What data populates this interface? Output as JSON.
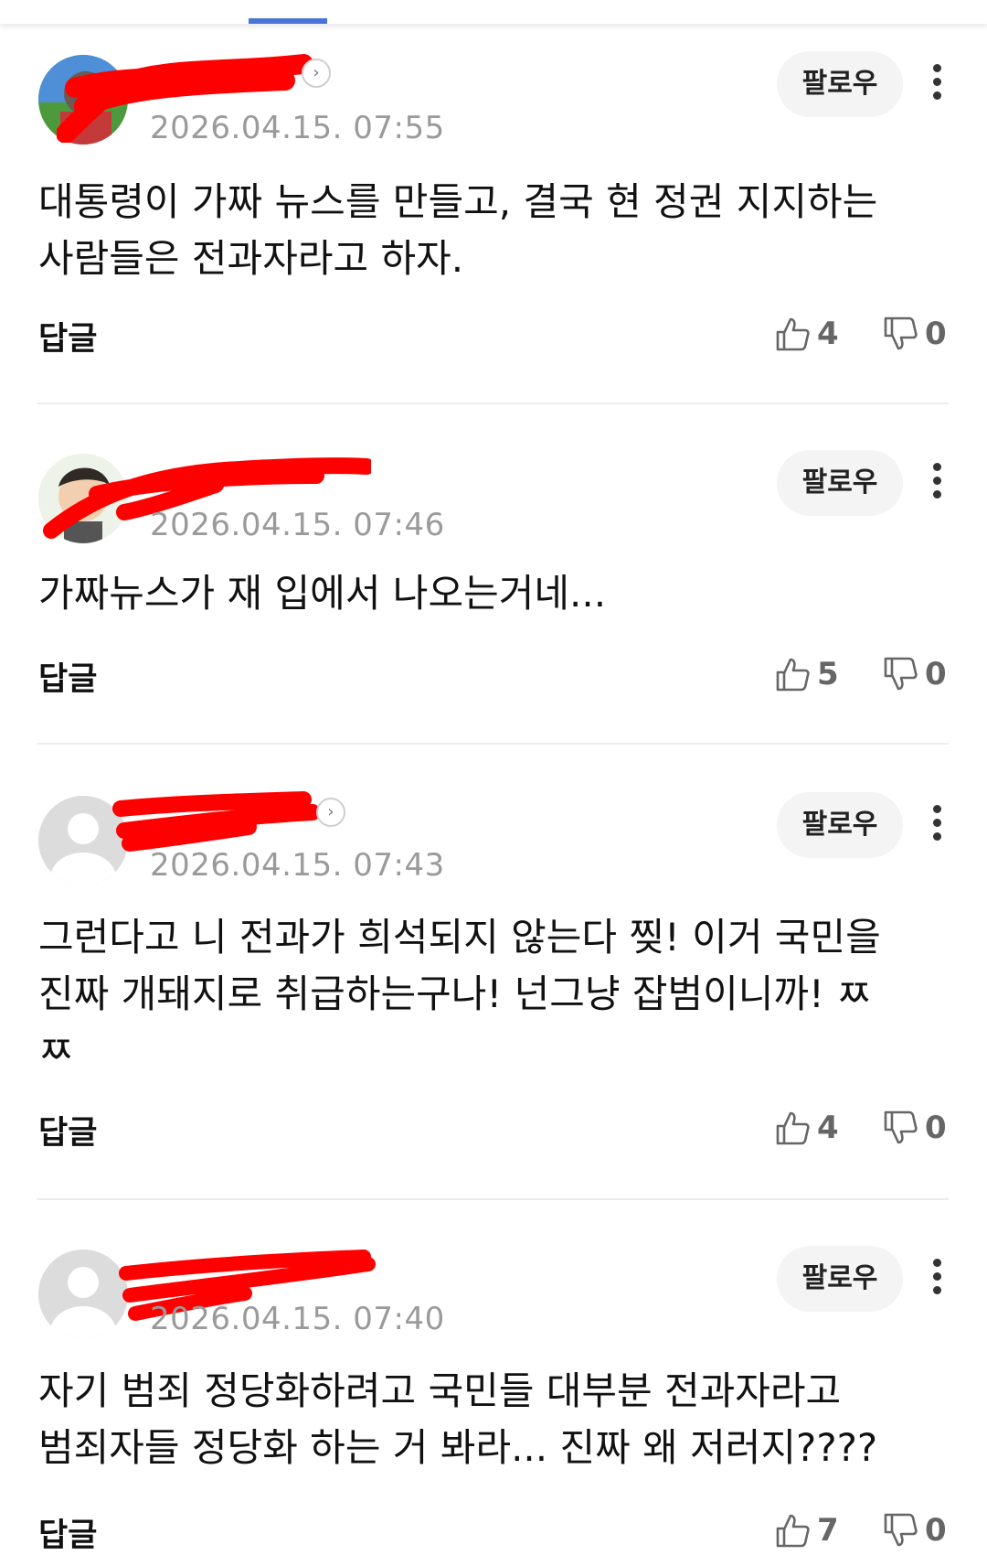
{
  "comments": [
    {
      "time": "2026.04.15. 07:55",
      "follow_label": "팔로우",
      "text": "대통령이 가짜 뉴스를 만들고, 결국 현 정권 지지하는\n사람들은 전과자라고 하자.",
      "reply_label": "답글",
      "likes": "4",
      "dislikes": "0",
      "avatar": "custom-photo-avatar-icon"
    },
    {
      "time": "2026.04.15. 07:46",
      "follow_label": "팔로우",
      "text": "가짜뉴스가 재 입에서 나오는거네...",
      "reply_label": "답글",
      "likes": "5",
      "dislikes": "0",
      "avatar": "cartoon-face-avatar-icon"
    },
    {
      "time": "2026.04.15. 07:43",
      "follow_label": "팔로우",
      "text": "그런다고 니 전과가 희석되지 않는다 찢! 이거 국민을\n진짜 개돼지로 취급하는구나! 넌그냥 잡범이니까! ㅉ\nㅉ",
      "reply_label": "답글",
      "likes": "4",
      "dislikes": "0",
      "avatar": "default-person-avatar-icon"
    },
    {
      "time": "2026.04.15. 07:40",
      "follow_label": "팔로우",
      "text": "자기 범죄 정당화하려고 국민들 대부분 전과자라고\n범죄자들 정당화 하는 거 봐라... 진짜 왜 저러지????",
      "reply_label": "답글",
      "likes": "7",
      "dislikes": "0",
      "avatar": "default-person-avatar-icon"
    }
  ],
  "icons": {
    "like": "thumbs-up-icon",
    "dislike": "thumbs-down-icon",
    "more": "more-vertical-icon",
    "nickname_arrow": "chevron-right-icon"
  },
  "colors": {
    "tab_indicator": "#4a74d6",
    "redaction": "#ff0000",
    "timestamp": "#9a9a9a"
  }
}
